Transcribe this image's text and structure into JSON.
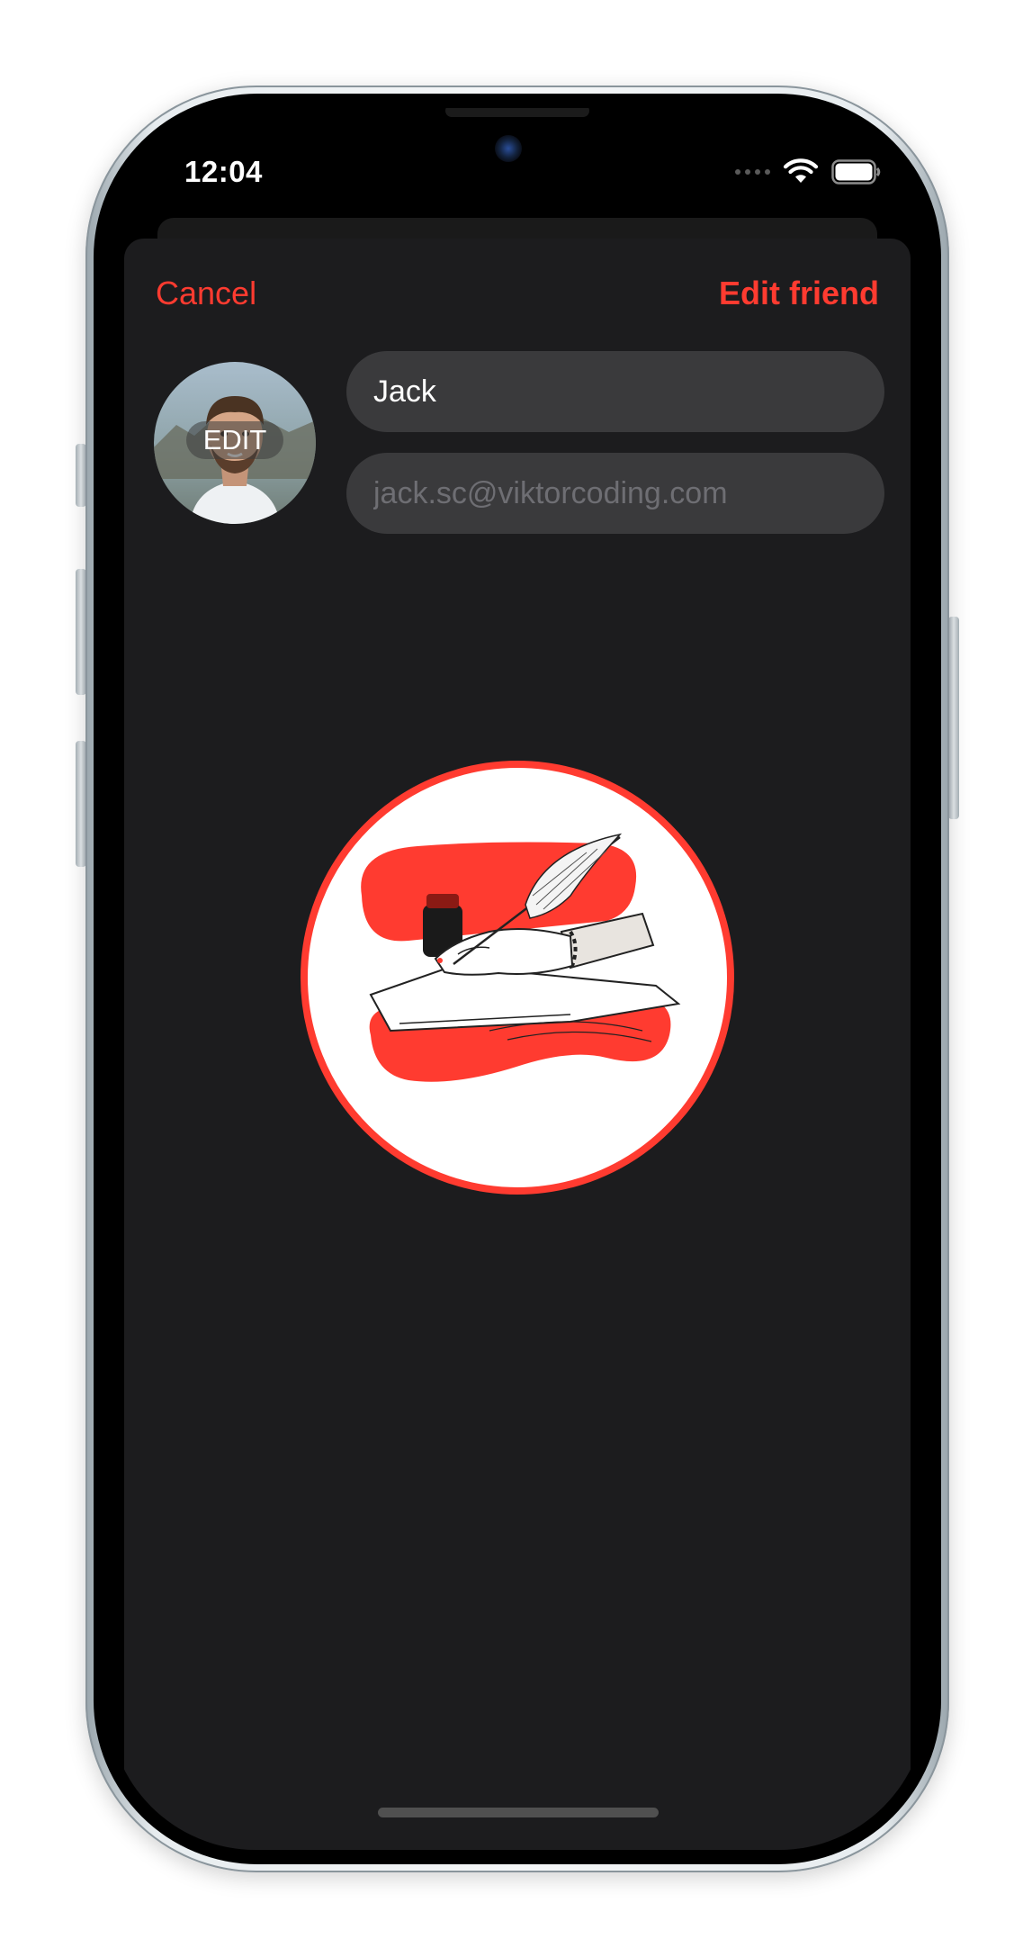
{
  "status_bar": {
    "time": "12:04"
  },
  "nav": {
    "cancel_label": "Cancel",
    "title": "Edit friend"
  },
  "avatar": {
    "edit_label": "EDIT"
  },
  "form": {
    "name_value": "Jack",
    "email_placeholder": "jack.sc@viktorcoding.com"
  },
  "icons": {
    "wifi": "wifi-icon",
    "battery": "battery-icon",
    "cellular": "cellular-dots-icon",
    "emblem": "quill-writing-illustration"
  },
  "colors": {
    "accent": "#ff3b30",
    "sheet_background": "#1c1c1e",
    "field_background": "#3a3a3c",
    "placeholder": "#6e6e73"
  }
}
